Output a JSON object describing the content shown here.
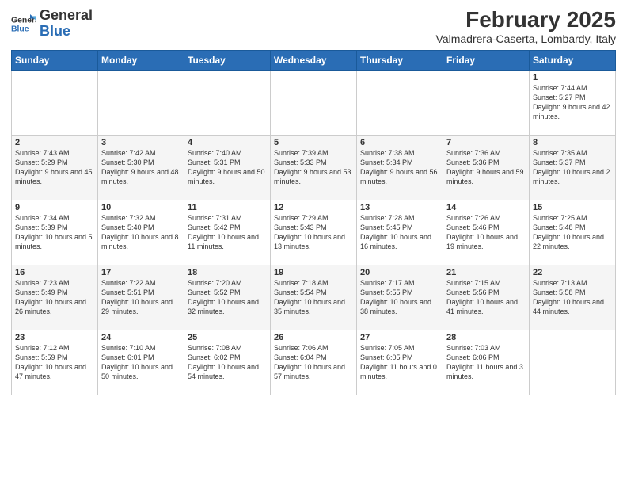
{
  "header": {
    "logo_general": "General",
    "logo_blue": "Blue",
    "title": "February 2025",
    "subtitle": "Valmadrera-Caserta, Lombardy, Italy"
  },
  "days_of_week": [
    "Sunday",
    "Monday",
    "Tuesday",
    "Wednesday",
    "Thursday",
    "Friday",
    "Saturday"
  ],
  "weeks": [
    [
      {
        "day": "",
        "info": ""
      },
      {
        "day": "",
        "info": ""
      },
      {
        "day": "",
        "info": ""
      },
      {
        "day": "",
        "info": ""
      },
      {
        "day": "",
        "info": ""
      },
      {
        "day": "",
        "info": ""
      },
      {
        "day": "1",
        "info": "Sunrise: 7:44 AM\nSunset: 5:27 PM\nDaylight: 9 hours and 42 minutes."
      }
    ],
    [
      {
        "day": "2",
        "info": "Sunrise: 7:43 AM\nSunset: 5:29 PM\nDaylight: 9 hours and 45 minutes."
      },
      {
        "day": "3",
        "info": "Sunrise: 7:42 AM\nSunset: 5:30 PM\nDaylight: 9 hours and 48 minutes."
      },
      {
        "day": "4",
        "info": "Sunrise: 7:40 AM\nSunset: 5:31 PM\nDaylight: 9 hours and 50 minutes."
      },
      {
        "day": "5",
        "info": "Sunrise: 7:39 AM\nSunset: 5:33 PM\nDaylight: 9 hours and 53 minutes."
      },
      {
        "day": "6",
        "info": "Sunrise: 7:38 AM\nSunset: 5:34 PM\nDaylight: 9 hours and 56 minutes."
      },
      {
        "day": "7",
        "info": "Sunrise: 7:36 AM\nSunset: 5:36 PM\nDaylight: 9 hours and 59 minutes."
      },
      {
        "day": "8",
        "info": "Sunrise: 7:35 AM\nSunset: 5:37 PM\nDaylight: 10 hours and 2 minutes."
      }
    ],
    [
      {
        "day": "9",
        "info": "Sunrise: 7:34 AM\nSunset: 5:39 PM\nDaylight: 10 hours and 5 minutes."
      },
      {
        "day": "10",
        "info": "Sunrise: 7:32 AM\nSunset: 5:40 PM\nDaylight: 10 hours and 8 minutes."
      },
      {
        "day": "11",
        "info": "Sunrise: 7:31 AM\nSunset: 5:42 PM\nDaylight: 10 hours and 11 minutes."
      },
      {
        "day": "12",
        "info": "Sunrise: 7:29 AM\nSunset: 5:43 PM\nDaylight: 10 hours and 13 minutes."
      },
      {
        "day": "13",
        "info": "Sunrise: 7:28 AM\nSunset: 5:45 PM\nDaylight: 10 hours and 16 minutes."
      },
      {
        "day": "14",
        "info": "Sunrise: 7:26 AM\nSunset: 5:46 PM\nDaylight: 10 hours and 19 minutes."
      },
      {
        "day": "15",
        "info": "Sunrise: 7:25 AM\nSunset: 5:48 PM\nDaylight: 10 hours and 22 minutes."
      }
    ],
    [
      {
        "day": "16",
        "info": "Sunrise: 7:23 AM\nSunset: 5:49 PM\nDaylight: 10 hours and 26 minutes."
      },
      {
        "day": "17",
        "info": "Sunrise: 7:22 AM\nSunset: 5:51 PM\nDaylight: 10 hours and 29 minutes."
      },
      {
        "day": "18",
        "info": "Sunrise: 7:20 AM\nSunset: 5:52 PM\nDaylight: 10 hours and 32 minutes."
      },
      {
        "day": "19",
        "info": "Sunrise: 7:18 AM\nSunset: 5:54 PM\nDaylight: 10 hours and 35 minutes."
      },
      {
        "day": "20",
        "info": "Sunrise: 7:17 AM\nSunset: 5:55 PM\nDaylight: 10 hours and 38 minutes."
      },
      {
        "day": "21",
        "info": "Sunrise: 7:15 AM\nSunset: 5:56 PM\nDaylight: 10 hours and 41 minutes."
      },
      {
        "day": "22",
        "info": "Sunrise: 7:13 AM\nSunset: 5:58 PM\nDaylight: 10 hours and 44 minutes."
      }
    ],
    [
      {
        "day": "23",
        "info": "Sunrise: 7:12 AM\nSunset: 5:59 PM\nDaylight: 10 hours and 47 minutes."
      },
      {
        "day": "24",
        "info": "Sunrise: 7:10 AM\nSunset: 6:01 PM\nDaylight: 10 hours and 50 minutes."
      },
      {
        "day": "25",
        "info": "Sunrise: 7:08 AM\nSunset: 6:02 PM\nDaylight: 10 hours and 54 minutes."
      },
      {
        "day": "26",
        "info": "Sunrise: 7:06 AM\nSunset: 6:04 PM\nDaylight: 10 hours and 57 minutes."
      },
      {
        "day": "27",
        "info": "Sunrise: 7:05 AM\nSunset: 6:05 PM\nDaylight: 11 hours and 0 minutes."
      },
      {
        "day": "28",
        "info": "Sunrise: 7:03 AM\nSunset: 6:06 PM\nDaylight: 11 hours and 3 minutes."
      },
      {
        "day": "",
        "info": ""
      }
    ]
  ]
}
